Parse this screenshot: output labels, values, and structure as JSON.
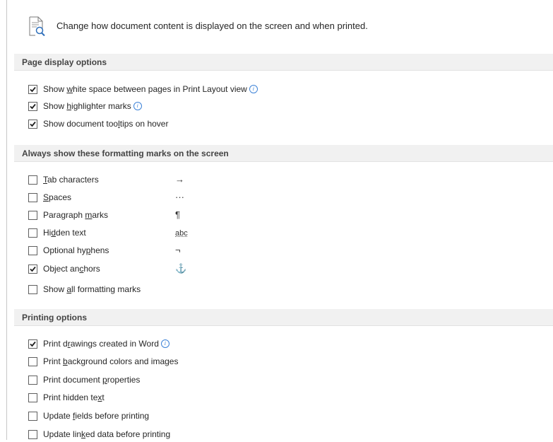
{
  "header": {
    "icon": "document-view-icon",
    "text": "Change how document content is displayed on the screen and when printed."
  },
  "sections": {
    "page_display": {
      "title": "Page display options",
      "items": [
        {
          "pre": "Show ",
          "key": "w",
          "post": "hite space between pages in Print Layout view",
          "checked": true,
          "info": true
        },
        {
          "pre": "Show ",
          "key": "h",
          "post": "ighlighter marks",
          "checked": true,
          "info": true
        },
        {
          "pre": "Show document too",
          "key": "l",
          "post": "tips on hover",
          "checked": true,
          "info": false
        }
      ]
    },
    "formatting_marks": {
      "title": "Always show these formatting marks on the screen",
      "items": [
        {
          "pre": "",
          "key": "T",
          "post": "ab characters",
          "checked": false,
          "mark": "→"
        },
        {
          "pre": "",
          "key": "S",
          "post": "paces",
          "checked": false,
          "mark": "···"
        },
        {
          "pre": "Paragraph ",
          "key": "m",
          "post": "arks",
          "checked": false,
          "mark": "¶"
        },
        {
          "pre": "Hi",
          "key": "d",
          "post": "den text",
          "checked": false,
          "mark": "abc"
        },
        {
          "pre": "Optional hy",
          "key": "p",
          "post": "hens",
          "checked": false,
          "mark": "¬"
        },
        {
          "pre": "Object an",
          "key": "c",
          "post": "hors",
          "checked": true,
          "mark": "⚓"
        },
        {
          "pre": "Show ",
          "key": "a",
          "post": "ll formatting marks",
          "checked": false,
          "mark": ""
        }
      ]
    },
    "printing": {
      "title": "Printing options",
      "items": [
        {
          "pre": "Print d",
          "key": "r",
          "post": "awings created in Word",
          "checked": true,
          "info": true
        },
        {
          "pre": "Print ",
          "key": "b",
          "post": "ackground colors and images",
          "checked": false,
          "info": false
        },
        {
          "pre": "Print document ",
          "key": "p",
          "post": "roperties",
          "checked": false,
          "info": false
        },
        {
          "pre": "Print hidden te",
          "key": "x",
          "post": "t",
          "checked": false,
          "info": false
        },
        {
          "pre": "Update ",
          "key": "f",
          "post": "ields before printing",
          "checked": false,
          "info": false
        },
        {
          "pre": "Update lin",
          "key": "k",
          "post": "ed data before printing",
          "checked": false,
          "info": false
        }
      ]
    }
  },
  "colors": {
    "section_bg": "#f1f1f1",
    "info_blue": "#3c82d7",
    "checkbox_border": "#5f5f5f"
  }
}
